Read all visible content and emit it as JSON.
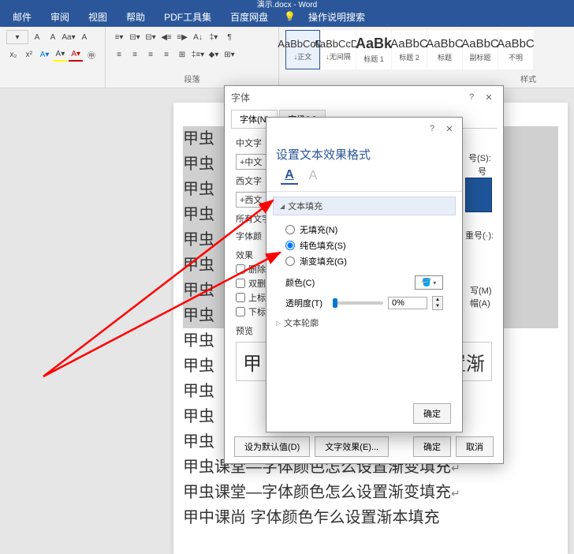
{
  "app": {
    "title": "演示.docx - Word"
  },
  "menu": {
    "items": [
      "邮件",
      "审阅",
      "视图",
      "帮助",
      "PDF工具集",
      "百度网盘"
    ],
    "search_hint": "操作说明搜索"
  },
  "ribbon": {
    "paragraph_label": "段落",
    "styles_label": "样式",
    "styles": [
      {
        "preview": "AaBbCcDc",
        "label": "↓正文"
      },
      {
        "preview": "AaBbCcDc",
        "label": "↓无间隔"
      },
      {
        "preview": "AaBk",
        "label": "标题 1"
      },
      {
        "preview": "AaBbC",
        "label": "标题 2"
      },
      {
        "preview": "AaBbC",
        "label": "标题"
      },
      {
        "preview": "AaBbC",
        "label": "副标题"
      },
      {
        "preview": "AaBbC",
        "label": "不明"
      }
    ]
  },
  "document": {
    "sel_lines": [
      "甲虫",
      "甲虫",
      "甲虫",
      "甲虫",
      "甲虫",
      "甲虫",
      "甲虫",
      "甲虫"
    ],
    "plain_lines": [
      "甲虫",
      "甲虫",
      "甲虫",
      "甲虫",
      "甲虫"
    ],
    "full_line1": "甲虫课堂—字体颜色怎么设置渐变填充",
    "full_line2": "甲虫课堂—字体颜色怎么设置渐变填充",
    "full_line3": "甲中课尚    字体颜色乍么设置渐本填充"
  },
  "font_dialog": {
    "title": "字体",
    "help": "?",
    "tabs": {
      "font": "字体(N)",
      "advanced": "高级(V)"
    },
    "labels": {
      "cn_font": "中文字",
      "cn_combo": "+中文",
      "west_font": "西文字",
      "west_combo": "+西文",
      "all_text": "所有文字",
      "font_color": "字体颜",
      "effects": "效果",
      "strike": "删除",
      "double": "双删",
      "super": "上标",
      "sub": "下标",
      "preview": "预览",
      "style_s": "号(S):",
      "hao": "号",
      "underline": "重号(·):"
    },
    "side_labels": {
      "m": "写(M)",
      "a": "帽(A)"
    },
    "preview_text": "甲",
    "preview_suffix": "置渐",
    "buttons": {
      "default": "设为默认值(D)",
      "text_effects": "文字效果(E)...",
      "ok": "确定",
      "cancel": "取消"
    }
  },
  "effect_panel": {
    "title": "设置文本效果格式",
    "help": "?",
    "section_fill": "文本填充",
    "radio_none": "无填充(N)",
    "radio_solid": "纯色填充(S)",
    "radio_gradient": "渐变填充(G)",
    "color_label": "颜色(C)",
    "opacity_label": "透明度(T)",
    "opacity_value": "0%",
    "section_outline": "文本轮廓",
    "ok_btn": "确定"
  },
  "chart_data": null
}
